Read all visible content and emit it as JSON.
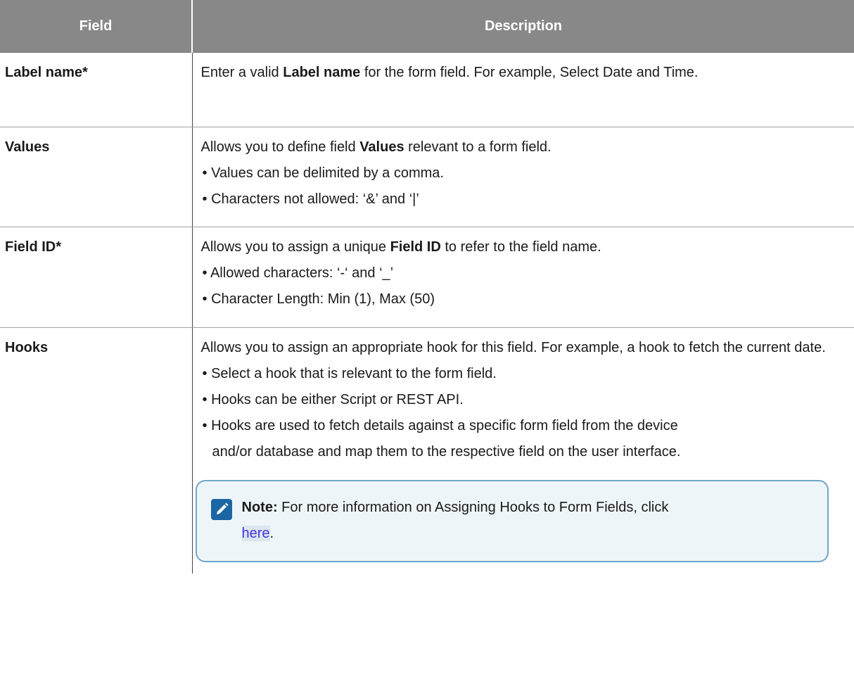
{
  "table": {
    "headers": [
      "Field",
      "Description"
    ],
    "rows": [
      {
        "field": "Label name*",
        "intro": {
          "pre": "Enter a valid ",
          "bold": "Label name",
          "post": " for the form field. For example, Select Date and Time."
        }
      },
      {
        "field": "Values",
        "intro": {
          "pre": "Allows you to define field ",
          "bold": "Values",
          "post": " relevant to a form field."
        },
        "bullets": [
          "Values can be delimited by a comma.",
          "Characters not allowed: ‘&’ and ‘|’"
        ]
      },
      {
        "field": "Field ID*",
        "intro": {
          "pre": "Allows you to assign a unique ",
          "bold": "Field ID",
          "post": " to refer to the field name."
        },
        "bullets": [
          "Allowed characters: ‘-‘ and ‘_’",
          "Character Length: Min (1), Max (50)"
        ]
      },
      {
        "field": "Hooks",
        "intro": {
          "text": "Allows you to assign an appropriate hook for this field. For example, a hook to fetch the current date."
        },
        "bullets": [
          "Select a hook that is relevant to the form field.",
          "Hooks can be either Script or REST API.",
          {
            "line1": "Hooks are used to fetch details against a specific form field from the device",
            "line2": "and/or database and map them to the respective field on the user interface."
          }
        ],
        "note": {
          "icon": "pencil-note-icon",
          "label": "Note:",
          "text": " For more information on Assigning Hooks to Form Fields, click",
          "link": "here",
          "end": "."
        }
      }
    ]
  },
  "bullet_symbol": "•"
}
